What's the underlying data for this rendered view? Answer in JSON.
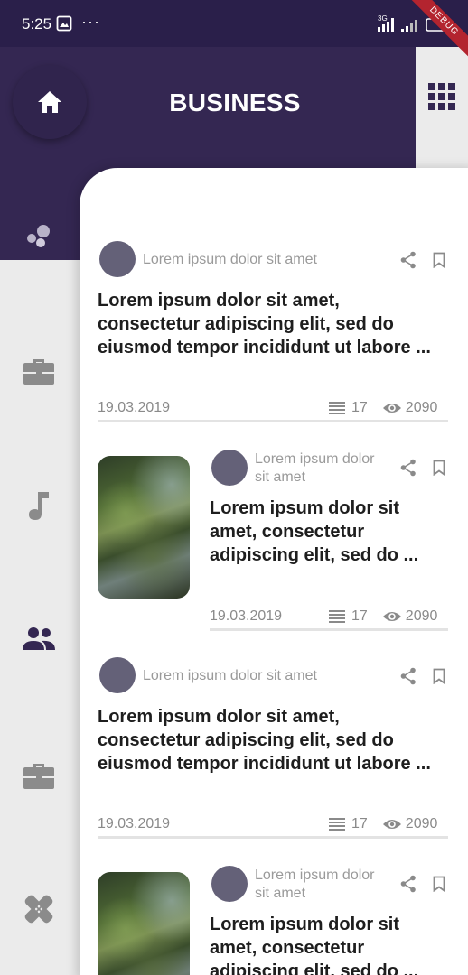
{
  "status": {
    "time": "5:25",
    "dots": "···",
    "network": "3G"
  },
  "debug_label": "DEBUG",
  "header": {
    "title": "BUSINESS"
  },
  "sidebar": {
    "items": [
      {
        "icon": "dots-icon"
      },
      {
        "icon": "briefcase-icon"
      },
      {
        "icon": "music-note-icon"
      },
      {
        "icon": "people-icon",
        "active": true
      },
      {
        "icon": "briefcase-icon"
      },
      {
        "icon": "bandage-icon"
      }
    ]
  },
  "articles": [
    {
      "layout": "full",
      "author": "Lorem ipsum dolor sit amet",
      "title_lines": [
        "Lorem ipsum dolor sit amet,",
        "consectetur adipiscing elit, sed do",
        "eiusmod tempor incididunt ut labore ..."
      ],
      "date": "19.03.2019",
      "count": "17",
      "views": "2090"
    },
    {
      "layout": "thumbnail",
      "author_lines": [
        "Lorem ipsum dolor",
        "sit amet"
      ],
      "title_lines": [
        "Lorem ipsum dolor sit",
        "amet, consectetur",
        "adipiscing elit, sed do ..."
      ],
      "date": "19.03.2019",
      "count": "17",
      "views": "2090"
    },
    {
      "layout": "full",
      "author": "Lorem ipsum dolor sit amet",
      "title_lines": [
        "Lorem ipsum dolor sit amet,",
        "consectetur adipiscing elit, sed do",
        "eiusmod tempor incididunt ut labore ..."
      ],
      "date": "19.03.2019",
      "count": "17",
      "views": "2090"
    },
    {
      "layout": "thumbnail",
      "author_lines": [
        "Lorem ipsum dolor",
        "sit amet"
      ],
      "title_lines": [
        "Lorem ipsum dolor sit",
        "amet, consectetur",
        "adipiscing elit, sed do ..."
      ]
    }
  ],
  "colors": {
    "header": "#342752",
    "status_bar": "#2a1f4a",
    "accent": "#342752",
    "sidebar_bg": "#ebebeb"
  }
}
